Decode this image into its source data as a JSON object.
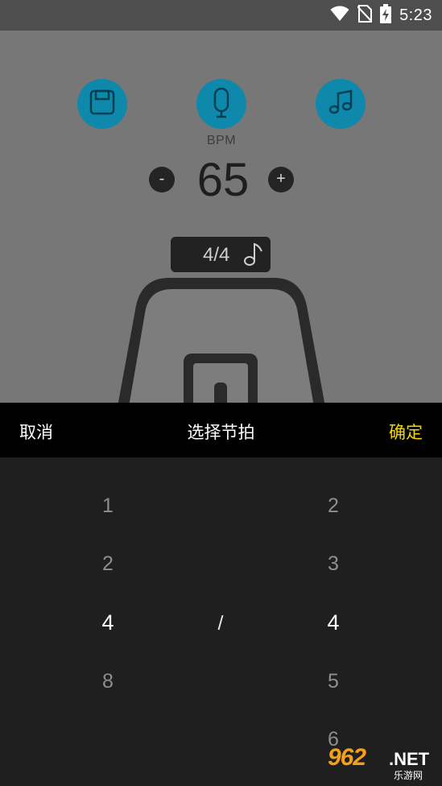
{
  "status_bar": {
    "time": "5:23",
    "icons": [
      "wifi-icon",
      "no-sim-icon",
      "battery-charging-icon"
    ]
  },
  "metronome": {
    "top_buttons": [
      "save-icon",
      "mic-icon",
      "music-notes-icon"
    ],
    "bpm_label": "BPM",
    "bpm_value": "65",
    "minus_label": "-",
    "plus_label": "+",
    "time_signature": "4/4",
    "accent_color": "#0e88ab"
  },
  "dialog": {
    "cancel_label": "取消",
    "title": "选择节拍",
    "confirm_label": "确定",
    "confirm_color": "#f2d60c"
  },
  "picker": {
    "left_column": [
      "1",
      "2",
      "4",
      "8"
    ],
    "left_selected": "4",
    "separator": "/",
    "right_column": [
      "2",
      "3",
      "4",
      "5",
      "6"
    ],
    "right_selected": "4"
  },
  "watermark": {
    "brand": "962",
    "suffix": ".NET",
    "subtitle": "乐游网"
  }
}
